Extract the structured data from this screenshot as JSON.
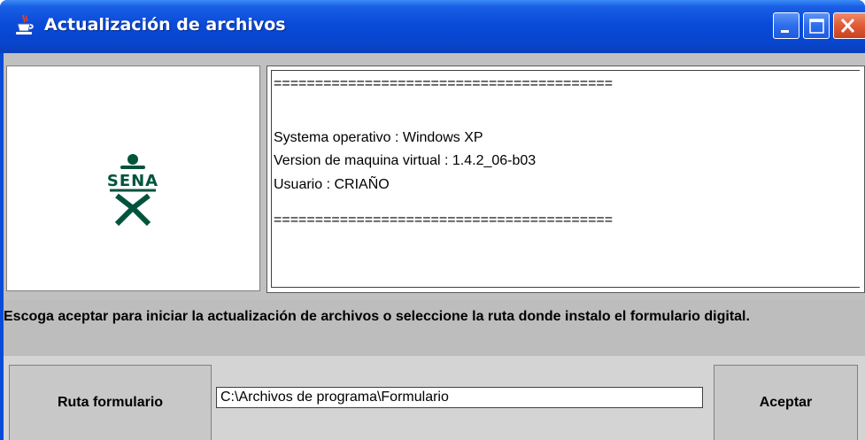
{
  "window": {
    "title": "Actualización de archivos",
    "app_icon": "java-cup-icon",
    "controls": [
      "minimize-icon",
      "maximize-icon",
      "close-icon"
    ]
  },
  "logo": {
    "text": "SENA",
    "color": "#00543c"
  },
  "info": {
    "separator_top": "=========================================",
    "os_line": "Systema operativo : Windows XP",
    "vm_line": "Version de maquina virtual : 1.4.2_06-b03",
    "user_line": "Usuario : CRIAÑO",
    "separator_bottom": "========================================="
  },
  "message": {
    "text": "Escoga aceptar para iniciar la actualización de archivos o seleccione la ruta donde instalo el formulario digital."
  },
  "actions": {
    "ruta_label": "Ruta formulario",
    "path_value": "C:\\Archivos de programa\\Formulario",
    "aceptar_label": "Aceptar"
  },
  "colors": {
    "titlebar": "#0a4ad8",
    "close_button": "#e05a36",
    "panel_bg": "#c0c0c0"
  }
}
